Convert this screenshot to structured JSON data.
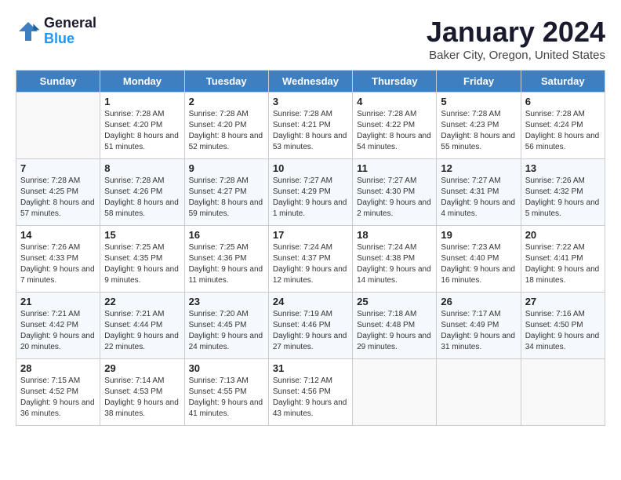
{
  "header": {
    "logo_general": "General",
    "logo_blue": "Blue",
    "month_title": "January 2024",
    "location": "Baker City, Oregon, United States"
  },
  "days_of_week": [
    "Sunday",
    "Monday",
    "Tuesday",
    "Wednesday",
    "Thursday",
    "Friday",
    "Saturday"
  ],
  "weeks": [
    [
      {
        "day": "",
        "sunrise": "",
        "sunset": "",
        "daylight": ""
      },
      {
        "day": "1",
        "sunrise": "Sunrise: 7:28 AM",
        "sunset": "Sunset: 4:20 PM",
        "daylight": "Daylight: 8 hours and 51 minutes."
      },
      {
        "day": "2",
        "sunrise": "Sunrise: 7:28 AM",
        "sunset": "Sunset: 4:20 PM",
        "daylight": "Daylight: 8 hours and 52 minutes."
      },
      {
        "day": "3",
        "sunrise": "Sunrise: 7:28 AM",
        "sunset": "Sunset: 4:21 PM",
        "daylight": "Daylight: 8 hours and 53 minutes."
      },
      {
        "day": "4",
        "sunrise": "Sunrise: 7:28 AM",
        "sunset": "Sunset: 4:22 PM",
        "daylight": "Daylight: 8 hours and 54 minutes."
      },
      {
        "day": "5",
        "sunrise": "Sunrise: 7:28 AM",
        "sunset": "Sunset: 4:23 PM",
        "daylight": "Daylight: 8 hours and 55 minutes."
      },
      {
        "day": "6",
        "sunrise": "Sunrise: 7:28 AM",
        "sunset": "Sunset: 4:24 PM",
        "daylight": "Daylight: 8 hours and 56 minutes."
      }
    ],
    [
      {
        "day": "7",
        "sunrise": "Sunrise: 7:28 AM",
        "sunset": "Sunset: 4:25 PM",
        "daylight": "Daylight: 8 hours and 57 minutes."
      },
      {
        "day": "8",
        "sunrise": "Sunrise: 7:28 AM",
        "sunset": "Sunset: 4:26 PM",
        "daylight": "Daylight: 8 hours and 58 minutes."
      },
      {
        "day": "9",
        "sunrise": "Sunrise: 7:28 AM",
        "sunset": "Sunset: 4:27 PM",
        "daylight": "Daylight: 8 hours and 59 minutes."
      },
      {
        "day": "10",
        "sunrise": "Sunrise: 7:27 AM",
        "sunset": "Sunset: 4:29 PM",
        "daylight": "Daylight: 9 hours and 1 minute."
      },
      {
        "day": "11",
        "sunrise": "Sunrise: 7:27 AM",
        "sunset": "Sunset: 4:30 PM",
        "daylight": "Daylight: 9 hours and 2 minutes."
      },
      {
        "day": "12",
        "sunrise": "Sunrise: 7:27 AM",
        "sunset": "Sunset: 4:31 PM",
        "daylight": "Daylight: 9 hours and 4 minutes."
      },
      {
        "day": "13",
        "sunrise": "Sunrise: 7:26 AM",
        "sunset": "Sunset: 4:32 PM",
        "daylight": "Daylight: 9 hours and 5 minutes."
      }
    ],
    [
      {
        "day": "14",
        "sunrise": "Sunrise: 7:26 AM",
        "sunset": "Sunset: 4:33 PM",
        "daylight": "Daylight: 9 hours and 7 minutes."
      },
      {
        "day": "15",
        "sunrise": "Sunrise: 7:25 AM",
        "sunset": "Sunset: 4:35 PM",
        "daylight": "Daylight: 9 hours and 9 minutes."
      },
      {
        "day": "16",
        "sunrise": "Sunrise: 7:25 AM",
        "sunset": "Sunset: 4:36 PM",
        "daylight": "Daylight: 9 hours and 11 minutes."
      },
      {
        "day": "17",
        "sunrise": "Sunrise: 7:24 AM",
        "sunset": "Sunset: 4:37 PM",
        "daylight": "Daylight: 9 hours and 12 minutes."
      },
      {
        "day": "18",
        "sunrise": "Sunrise: 7:24 AM",
        "sunset": "Sunset: 4:38 PM",
        "daylight": "Daylight: 9 hours and 14 minutes."
      },
      {
        "day": "19",
        "sunrise": "Sunrise: 7:23 AM",
        "sunset": "Sunset: 4:40 PM",
        "daylight": "Daylight: 9 hours and 16 minutes."
      },
      {
        "day": "20",
        "sunrise": "Sunrise: 7:22 AM",
        "sunset": "Sunset: 4:41 PM",
        "daylight": "Daylight: 9 hours and 18 minutes."
      }
    ],
    [
      {
        "day": "21",
        "sunrise": "Sunrise: 7:21 AM",
        "sunset": "Sunset: 4:42 PM",
        "daylight": "Daylight: 9 hours and 20 minutes."
      },
      {
        "day": "22",
        "sunrise": "Sunrise: 7:21 AM",
        "sunset": "Sunset: 4:44 PM",
        "daylight": "Daylight: 9 hours and 22 minutes."
      },
      {
        "day": "23",
        "sunrise": "Sunrise: 7:20 AM",
        "sunset": "Sunset: 4:45 PM",
        "daylight": "Daylight: 9 hours and 24 minutes."
      },
      {
        "day": "24",
        "sunrise": "Sunrise: 7:19 AM",
        "sunset": "Sunset: 4:46 PM",
        "daylight": "Daylight: 9 hours and 27 minutes."
      },
      {
        "day": "25",
        "sunrise": "Sunrise: 7:18 AM",
        "sunset": "Sunset: 4:48 PM",
        "daylight": "Daylight: 9 hours and 29 minutes."
      },
      {
        "day": "26",
        "sunrise": "Sunrise: 7:17 AM",
        "sunset": "Sunset: 4:49 PM",
        "daylight": "Daylight: 9 hours and 31 minutes."
      },
      {
        "day": "27",
        "sunrise": "Sunrise: 7:16 AM",
        "sunset": "Sunset: 4:50 PM",
        "daylight": "Daylight: 9 hours and 34 minutes."
      }
    ],
    [
      {
        "day": "28",
        "sunrise": "Sunrise: 7:15 AM",
        "sunset": "Sunset: 4:52 PM",
        "daylight": "Daylight: 9 hours and 36 minutes."
      },
      {
        "day": "29",
        "sunrise": "Sunrise: 7:14 AM",
        "sunset": "Sunset: 4:53 PM",
        "daylight": "Daylight: 9 hours and 38 minutes."
      },
      {
        "day": "30",
        "sunrise": "Sunrise: 7:13 AM",
        "sunset": "Sunset: 4:55 PM",
        "daylight": "Daylight: 9 hours and 41 minutes."
      },
      {
        "day": "31",
        "sunrise": "Sunrise: 7:12 AM",
        "sunset": "Sunset: 4:56 PM",
        "daylight": "Daylight: 9 hours and 43 minutes."
      },
      {
        "day": "",
        "sunrise": "",
        "sunset": "",
        "daylight": ""
      },
      {
        "day": "",
        "sunrise": "",
        "sunset": "",
        "daylight": ""
      },
      {
        "day": "",
        "sunrise": "",
        "sunset": "",
        "daylight": ""
      }
    ]
  ]
}
